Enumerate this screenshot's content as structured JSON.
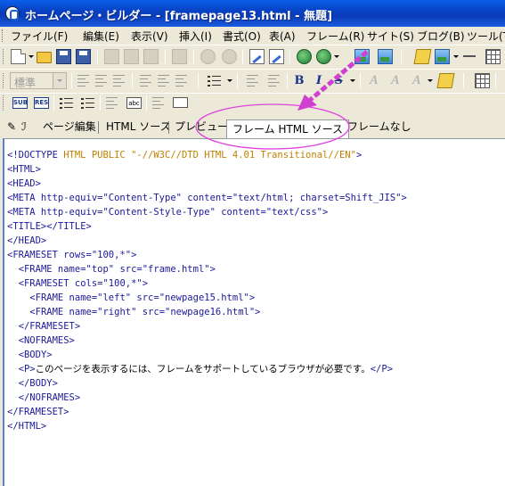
{
  "window": {
    "title": "ホームページ・ビルダー - [framepage13.html - 無題]"
  },
  "menu": {
    "items": [
      "ファイル(F)",
      "編集(E)",
      "表示(V)",
      "挿入(I)",
      "書式(O)",
      "表(A)",
      "フレーム(R)",
      "サイト(S)",
      "ブログ(B)",
      "ツール(T)"
    ]
  },
  "toolbar2": {
    "style_select": "標準"
  },
  "toolbar3": {
    "sub_label": "SUB",
    "res_label": "RES"
  },
  "tabs": {
    "items": [
      "ページ編集",
      "HTML ソース",
      "プレビュー",
      "フレーム HTML ソース",
      "フレームなし"
    ],
    "active": "フレーム HTML ソース"
  },
  "icons": [
    "new-page-icon",
    "open-folder-icon",
    "save-icon",
    "save-all-icon",
    "cut-icon",
    "copy-icon",
    "paste-icon",
    "check-icon",
    "undo-icon",
    "redo-icon",
    "edit-page-icon",
    "edit-page-2-icon",
    "insert-link-icon",
    "insert-object-icon",
    "image-icon",
    "picture-icon",
    "pencil-icon",
    "horizontal-line-icon",
    "table-icon"
  ],
  "colors": {
    "highlight_ellipse": "#e040e0",
    "arrow": "#d040d0",
    "doctype_text": "#c08000",
    "code_text": "#1a1a9a"
  },
  "source": {
    "lines": [
      "<!DOCTYPE HTML PUBLIC \"-//W3C//DTD HTML 4.01 Transitional//EN\">",
      "<HTML>",
      "<HEAD>",
      "<META http-equiv=\"Content-Type\" content=\"text/html; charset=Shift_JIS\">",
      "<META http-equiv=\"Content-Style-Type\" content=\"text/css\">",
      "<TITLE></TITLE>",
      "</HEAD>",
      "<FRAMESET rows=\"100,*\">",
      "  <FRAME name=\"top\" src=\"frame.html\">",
      "  <FRAMESET cols=\"100,*\">",
      "    <FRAME name=\"left\" src=\"newpage15.html\">",
      "    <FRAME name=\"right\" src=\"newpage16.html\">",
      "  </FRAMESET>",
      "  <NOFRAMES>",
      "  <BODY>",
      "  <P>このページを表示するには、フレームをサポートしているブラウザが必要です。</P>",
      "  </BODY>",
      "  </NOFRAMES>",
      "</FRAMESET>",
      "</HTML>"
    ]
  }
}
